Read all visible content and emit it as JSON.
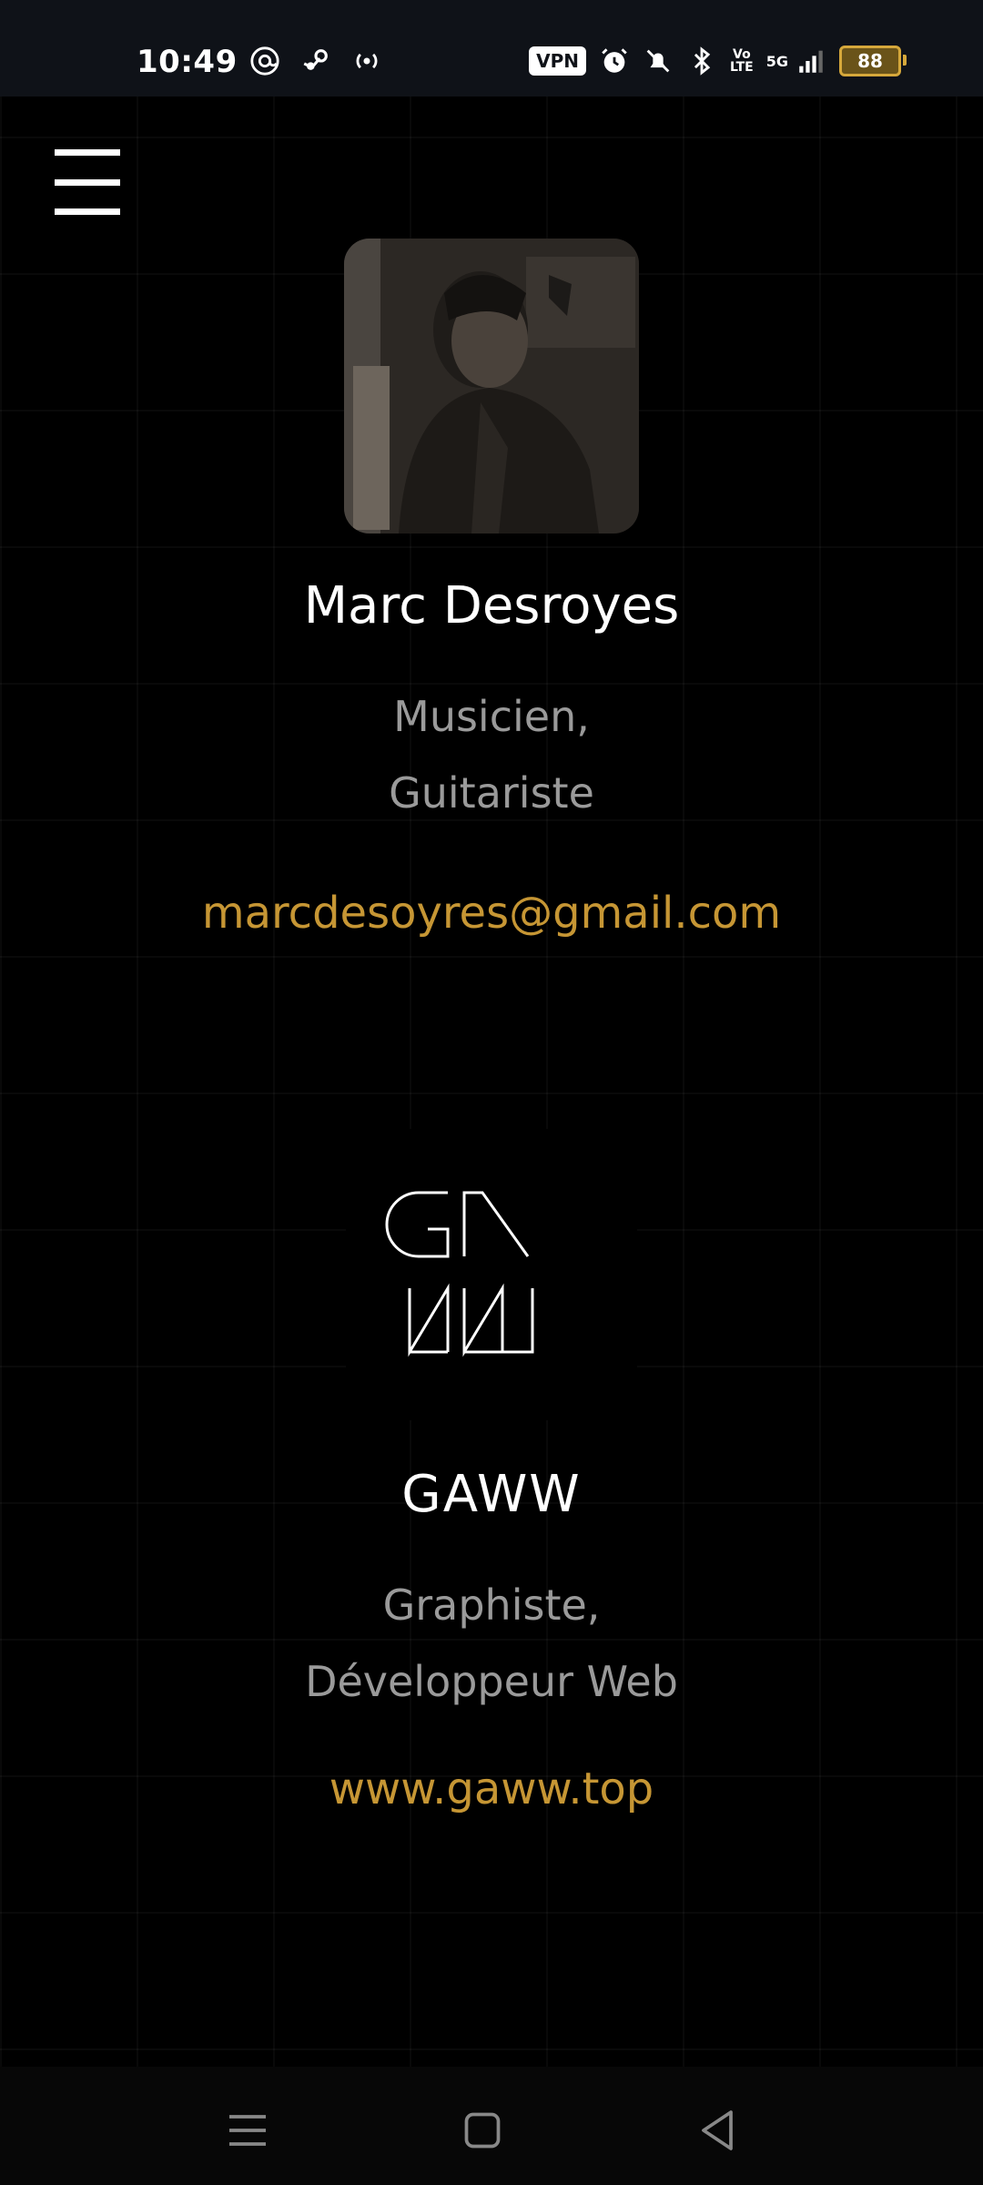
{
  "status_bar": {
    "time": "10:49",
    "vpn_label": "VPN",
    "lte_label": "Vo\nLTE",
    "signal_label": "5G",
    "battery": "88"
  },
  "profile": {
    "name": "Marc Desroyes",
    "role_line1": "Musicien,",
    "role_line2": "Guitariste",
    "email": "marcdesoyres@gmail.com"
  },
  "brand": {
    "name": "GAWW",
    "role_line1": "Graphiste,",
    "role_line2": "Développeur Web",
    "website": "www.gaww.top"
  },
  "colors": {
    "accent": "#c69634",
    "muted": "#9a9a9a",
    "background": "#000000"
  }
}
